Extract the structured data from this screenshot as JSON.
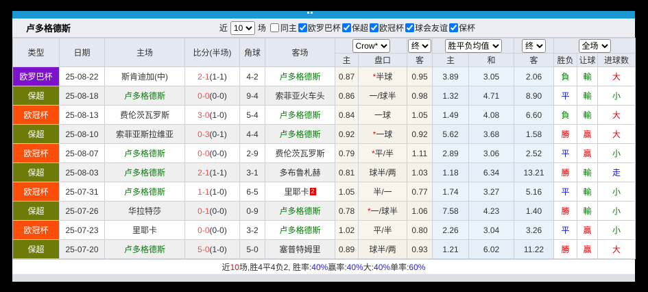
{
  "colors": {
    "topbar": "#1d97d3",
    "scrollbar": "#dcdfe4",
    "league": {
      "欧罗巴杯": "#7c12ca",
      "保超": "#6e7b08",
      "欧冠杯": "#fb4e0b"
    },
    "text": {
      "red": "#e60000",
      "green": "#008000",
      "blue": "#1414cc",
      "dark": "#333333"
    },
    "footer": {
      "dark": "#333333",
      "red": "#ff0000",
      "blue": "#2222dd"
    }
  },
  "filterbar": {
    "team": "卢多格德斯",
    "near": "近",
    "count": "10",
    "matches": "场",
    "same_host": "同主",
    "same_host_checked": false,
    "leagues": [
      {
        "label": "欧罗巴杯",
        "checked": true
      },
      {
        "label": "保超",
        "checked": true
      },
      {
        "label": "欧冠杯",
        "checked": true
      },
      {
        "label": "球会友谊",
        "checked": true
      },
      {
        "label": "保杯",
        "checked": true
      }
    ]
  },
  "selects": {
    "bookmaker": "Crow*",
    "final_a": "终",
    "avg": "胜平负均值",
    "final_b": "终",
    "scope": "全场"
  },
  "columns": {
    "main": [
      "类型",
      "日期",
      "主场",
      "比分(半场)",
      "角球",
      "客场"
    ],
    "sub": [
      "主",
      "盘口",
      "客",
      "主",
      "和",
      "客",
      "胜负",
      "让球",
      "进球数"
    ]
  },
  "rows": [
    {
      "league": "欧罗巴杯",
      "date": "25-08-22",
      "home": {
        "name": "斯肯迪加(中)",
        "green": false
      },
      "score": "2-1",
      "half": "(1-1)",
      "corner": "4-2",
      "away": {
        "name": "卢多格德斯",
        "green": true
      },
      "star": true,
      "crow": [
        "0.87",
        "半球",
        "0.95"
      ],
      "avg": [
        "3.89",
        "3.05",
        "2.06"
      ],
      "result": {
        "t": "負",
        "c": "green"
      },
      "handicap_result": {
        "t": "輸",
        "c": "green"
      },
      "goals": {
        "t": "大",
        "c": "red"
      }
    },
    {
      "league": "保超",
      "date": "25-08-18",
      "home": {
        "name": "卢多格德斯",
        "green": true
      },
      "score": "0-0",
      "half": "(0-0)",
      "corner": "9-4",
      "away": {
        "name": "索菲亚火车头",
        "green": false
      },
      "star": false,
      "crow": [
        "0.86",
        "一/球半",
        "0.98"
      ],
      "avg": [
        "1.32",
        "4.71",
        "8.90"
      ],
      "result": {
        "t": "平",
        "c": "blue"
      },
      "handicap_result": {
        "t": "輸",
        "c": "green"
      },
      "goals": {
        "t": "小",
        "c": "green"
      }
    },
    {
      "league": "欧冠杯",
      "date": "25-08-13",
      "home": {
        "name": "费伦茨瓦罗斯",
        "green": false
      },
      "score": "3-0",
      "half": "(1-0)",
      "corner": "5-4",
      "away": {
        "name": "卢多格德斯",
        "green": true
      },
      "star": false,
      "crow": [
        "0.84",
        "一球",
        "1.05"
      ],
      "avg": [
        "1.49",
        "4.08",
        "6.60"
      ],
      "result": {
        "t": "負",
        "c": "green"
      },
      "handicap_result": {
        "t": "輸",
        "c": "green"
      },
      "goals": {
        "t": "大",
        "c": "red"
      }
    },
    {
      "league": "保超",
      "date": "25-08-10",
      "home": {
        "name": "索菲亚斯拉维亚",
        "green": false
      },
      "score": "0-3",
      "half": "(0-1)",
      "corner": "4-4",
      "away": {
        "name": "卢多格德斯",
        "green": true
      },
      "star": true,
      "crow": [
        "0.92",
        "一球",
        "0.92"
      ],
      "avg": [
        "5.62",
        "3.68",
        "1.58"
      ],
      "result": {
        "t": "勝",
        "c": "red"
      },
      "handicap_result": {
        "t": "贏",
        "c": "red"
      },
      "goals": {
        "t": "大",
        "c": "red"
      }
    },
    {
      "league": "欧冠杯",
      "date": "25-08-07",
      "home": {
        "name": "卢多格德斯",
        "green": true
      },
      "score": "0-0",
      "half": "(0-0)",
      "corner": "2-9",
      "away": {
        "name": "费伦茨瓦罗斯",
        "green": false
      },
      "star": true,
      "crow": [
        "0.79",
        "平/半",
        "1.11"
      ],
      "avg": [
        "2.89",
        "3.06",
        "2.52"
      ],
      "result": {
        "t": "平",
        "c": "blue"
      },
      "handicap_result": {
        "t": "贏",
        "c": "red"
      },
      "goals": {
        "t": "小",
        "c": "green"
      }
    },
    {
      "league": "保超",
      "date": "25-08-03",
      "home": {
        "name": "卢多格德斯",
        "green": true
      },
      "score": "2-1",
      "half": "(1-1)",
      "corner": "3-1",
      "away": {
        "name": "多布鲁札赫",
        "green": false
      },
      "star": false,
      "crow": [
        "0.81",
        "球半/两",
        "1.03"
      ],
      "avg": [
        "1.18",
        "6.34",
        "13.21"
      ],
      "result": {
        "t": "勝",
        "c": "red"
      },
      "handicap_result": {
        "t": "輸",
        "c": "green"
      },
      "goals": {
        "t": "走",
        "c": "blue"
      }
    },
    {
      "league": "欧冠杯",
      "date": "25-07-31",
      "home": {
        "name": "卢多格德斯",
        "green": true
      },
      "score": "1-1",
      "half": "(1-0)",
      "corner": "6-5",
      "away": {
        "name": "里耶卡",
        "green": false,
        "redcard": "2"
      },
      "star": false,
      "crow": [
        "1.05",
        "半/一",
        "0.77"
      ],
      "avg": [
        "1.74",
        "3.27",
        "5.16"
      ],
      "result": {
        "t": "平",
        "c": "blue"
      },
      "handicap_result": {
        "t": "輸",
        "c": "green"
      },
      "goals": {
        "t": "小",
        "c": "green"
      }
    },
    {
      "league": "保超",
      "date": "25-07-26",
      "home": {
        "name": "华拉特莎",
        "green": false
      },
      "score": "0-1",
      "half": "(0-0)",
      "corner": "0-9",
      "away": {
        "name": "卢多格德斯",
        "green": true
      },
      "star": true,
      "crow": [
        "0.78",
        "一/球半",
        "1.06"
      ],
      "avg": [
        "7.58",
        "4.23",
        "1.40"
      ],
      "result": {
        "t": "勝",
        "c": "red"
      },
      "handicap_result": {
        "t": "輸",
        "c": "green"
      },
      "goals": {
        "t": "小",
        "c": "green"
      }
    },
    {
      "league": "欧冠杯",
      "date": "25-07-23",
      "home": {
        "name": "里耶卡",
        "green": false
      },
      "score": "0-0",
      "half": "(0-0)",
      "corner": "3-2",
      "away": {
        "name": "卢多格德斯",
        "green": true
      },
      "star": false,
      "crow": [
        "1.02",
        "平/半",
        "0.80"
      ],
      "avg": [
        "2.26",
        "3.04",
        "3.26"
      ],
      "result": {
        "t": "平",
        "c": "blue"
      },
      "handicap_result": {
        "t": "贏",
        "c": "red"
      },
      "goals": {
        "t": "小",
        "c": "green"
      }
    },
    {
      "league": "保超",
      "date": "25-07-20",
      "home": {
        "name": "卢多格德斯",
        "green": true
      },
      "score": "5-0",
      "half": "(1-0)",
      "corner": "5-0",
      "away": {
        "name": "塞普特姆里",
        "green": false
      },
      "star": false,
      "crow": [
        "0.89",
        "球半/两",
        "0.93"
      ],
      "avg": [
        "1.21",
        "6.02",
        "11.22"
      ],
      "result": {
        "t": "勝",
        "c": "red"
      },
      "handicap_result": {
        "t": "贏",
        "c": "red"
      },
      "goals": {
        "t": "大",
        "c": "red"
      }
    }
  ],
  "footer": [
    {
      "t": "近",
      "c": "dark"
    },
    {
      "t": "10",
      "c": "red"
    },
    {
      "t": "场,胜4平4负2, 胜率:",
      "c": "dark"
    },
    {
      "t": "40%",
      "c": "blue"
    },
    {
      "t": " 赢率:",
      "c": "dark"
    },
    {
      "t": "40%",
      "c": "blue"
    },
    {
      "t": " 大:",
      "c": "dark"
    },
    {
      "t": "40%",
      "c": "blue"
    },
    {
      "t": " 单率:",
      "c": "dark"
    },
    {
      "t": "60%",
      "c": "blue"
    }
  ]
}
